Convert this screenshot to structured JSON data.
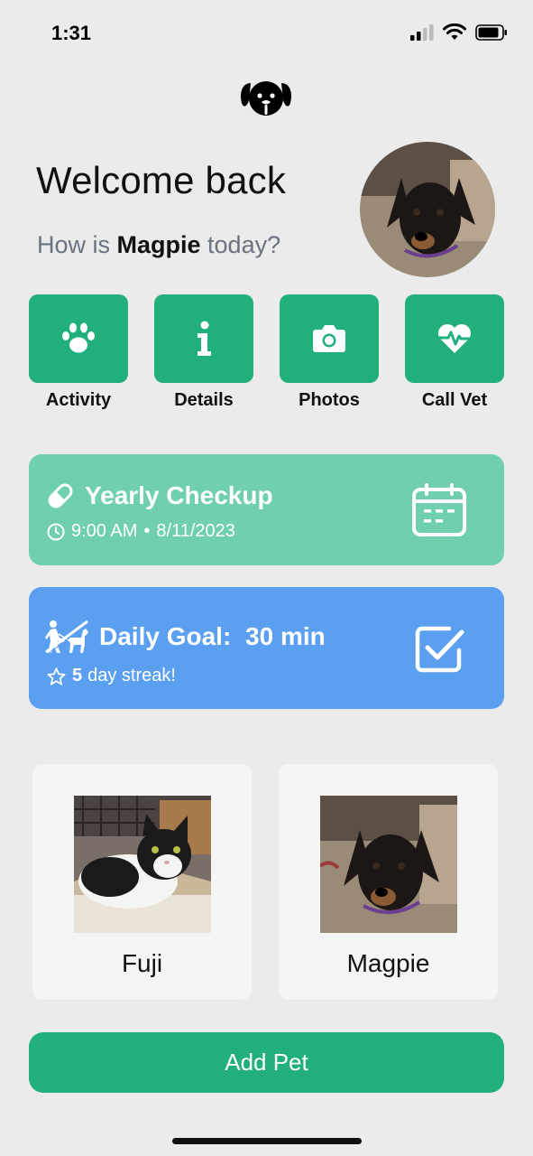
{
  "status_bar": {
    "time": "1:31"
  },
  "header": {
    "welcome": "Welcome back",
    "subtitle_prefix": "How is ",
    "pet_name": "Magpie",
    "subtitle_suffix": " today?"
  },
  "actions": [
    {
      "label": "Activity",
      "icon": "paw-icon"
    },
    {
      "label": "Details",
      "icon": "info-icon"
    },
    {
      "label": "Photos",
      "icon": "camera-icon"
    },
    {
      "label": "Call Vet",
      "icon": "heart-pulse-icon"
    }
  ],
  "appointment": {
    "title": "Yearly Checkup",
    "time": "9:00 AM",
    "separator": "•",
    "date": "8/11/2023"
  },
  "goal": {
    "title": "Daily Goal:",
    "value": "30 min",
    "streak_count": "5",
    "streak_text": "day streak!"
  },
  "pets": [
    {
      "name": "Fuji"
    },
    {
      "name": "Magpie"
    }
  ],
  "add_pet_label": "Add Pet",
  "colors": {
    "primary_green": "#22b07a",
    "light_green": "#6fcfaf",
    "blue": "#5a9ff0",
    "background": "#ebebeb"
  }
}
